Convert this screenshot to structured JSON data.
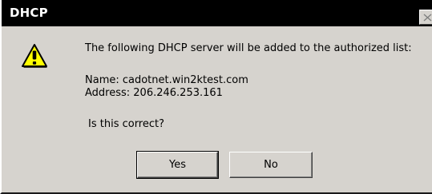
{
  "window": {
    "title": "DHCP",
    "close_glyph": "X"
  },
  "icons": {
    "warning": "warning-icon",
    "close": "close-icon"
  },
  "message": {
    "line1": "The following DHCP server will be added to the authorized list:",
    "name_row": "Name:  cadotnet.win2ktest.com",
    "address_row": "Address:  206.246.253.161",
    "question": "Is this correct?"
  },
  "buttons": {
    "yes_label": "Yes",
    "no_label": "No"
  },
  "colors": {
    "titlebar": "#000000",
    "dialog_face": "#d6d3ce",
    "warning_yellow": "#ffff00"
  }
}
